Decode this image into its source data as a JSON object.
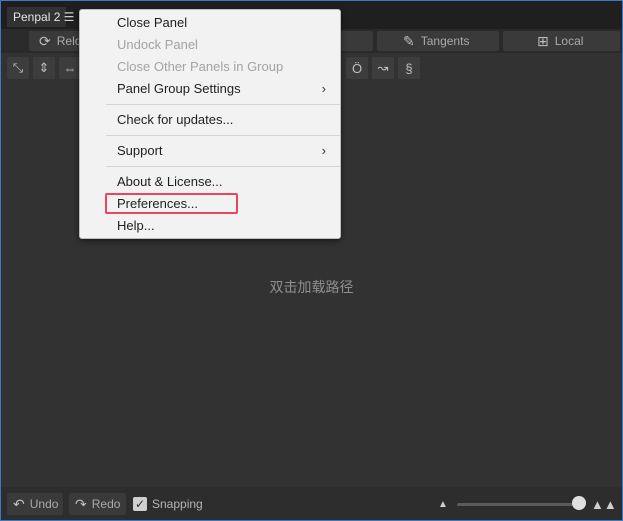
{
  "panel": {
    "title": "Penpal 2",
    "menu_icon": "hamburger-icon"
  },
  "tabs": [
    {
      "label": "Relo",
      "icon": "reload-icon"
    },
    {
      "label": "Tangents",
      "icon": "pen-icon"
    },
    {
      "label": "Local",
      "icon": "grid-icon"
    }
  ],
  "canvas": {
    "hint": "双击加载路径"
  },
  "bottom": {
    "undo_label": "Undo",
    "redo_label": "Redo",
    "snapping_label": "Snapping",
    "snapping_checked": true,
    "zoom_level": 0.98
  },
  "menu": {
    "items": [
      {
        "label": "Close Panel",
        "enabled": true
      },
      {
        "label": "Undock Panel",
        "enabled": false
      },
      {
        "label": "Close Other Panels in Group",
        "enabled": false
      },
      {
        "label": "Panel Group Settings",
        "enabled": true,
        "submenu": true
      },
      {
        "label": "Check for updates...",
        "enabled": true
      },
      {
        "label": "Support",
        "enabled": true,
        "submenu": true
      },
      {
        "label": "About & License...",
        "enabled": true
      },
      {
        "label": "Preferences...",
        "enabled": true,
        "highlighted": true
      },
      {
        "label": "Help...",
        "enabled": true
      }
    ],
    "highlight_color": "#e8455f"
  }
}
